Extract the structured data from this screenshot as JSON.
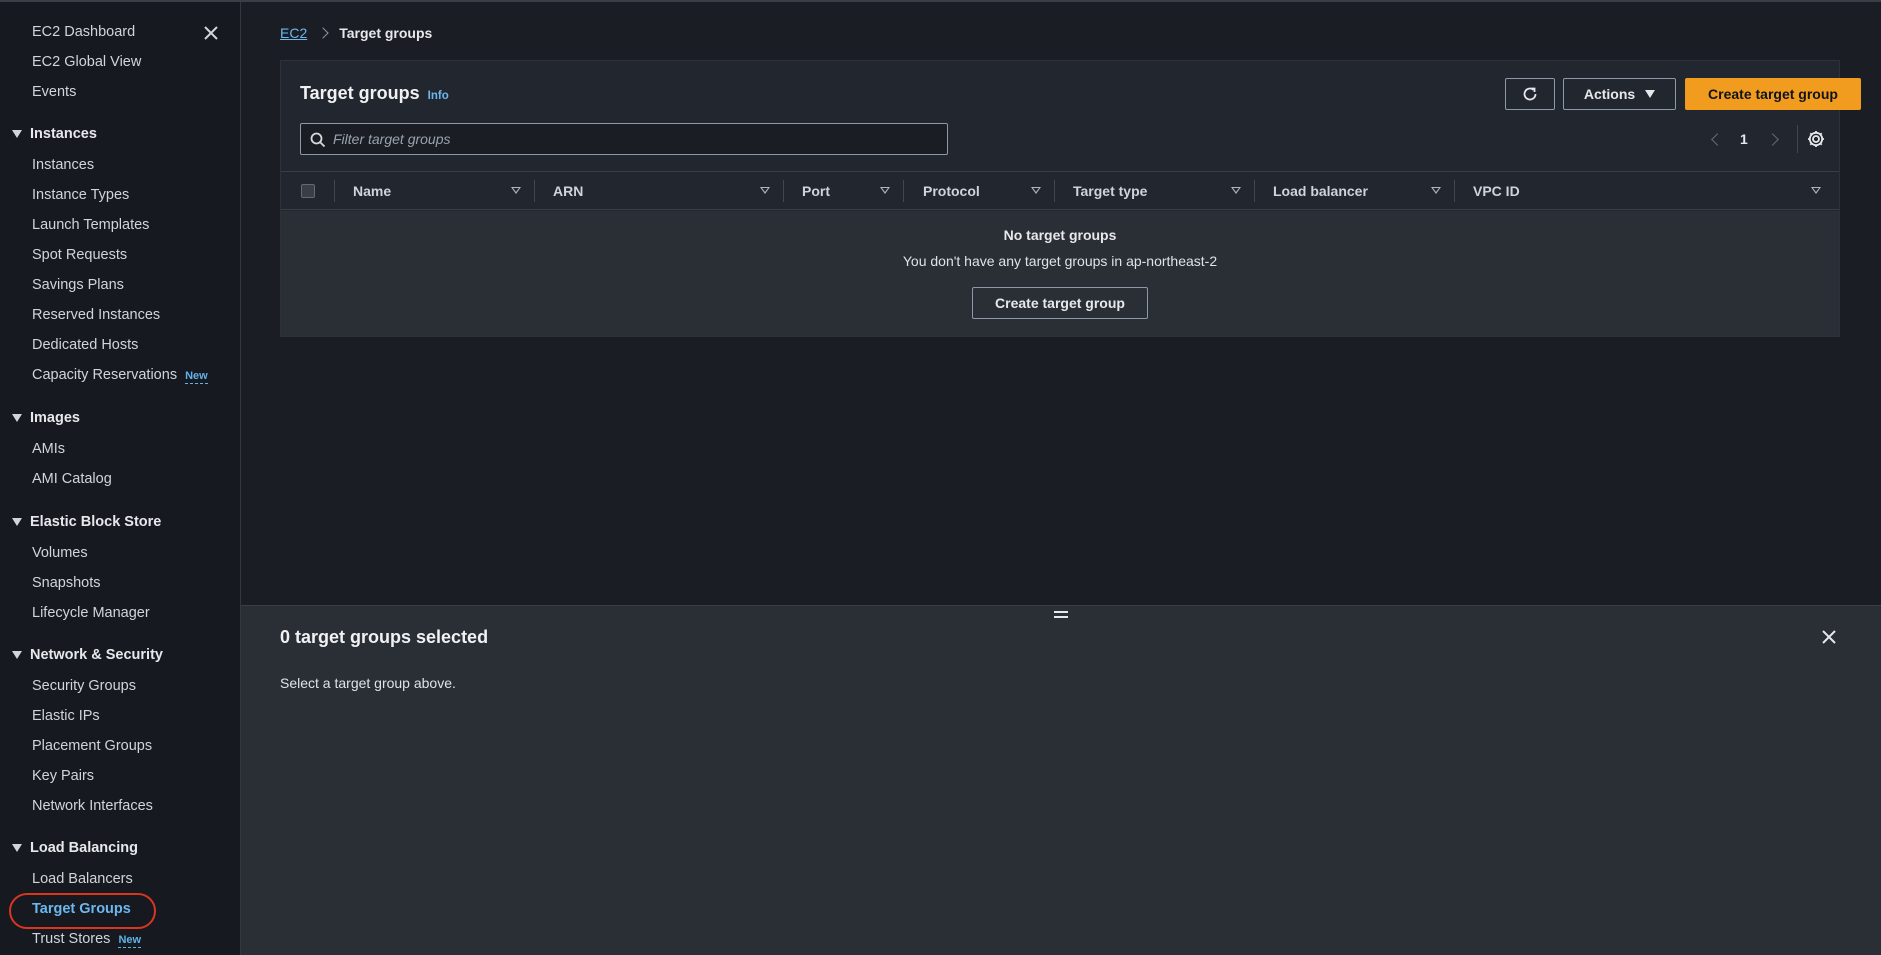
{
  "sidebar": {
    "top_items": [
      "EC2 Dashboard",
      "EC2 Global View",
      "Events"
    ],
    "sections": [
      {
        "title": "Instances",
        "items": [
          "Instances",
          "Instance Types",
          "Launch Templates",
          "Spot Requests",
          "Savings Plans",
          "Reserved Instances",
          "Dedicated Hosts",
          "Capacity Reservations"
        ]
      },
      {
        "title": "Images",
        "items": [
          "AMIs",
          "AMI Catalog"
        ]
      },
      {
        "title": "Elastic Block Store",
        "items": [
          "Volumes",
          "Snapshots",
          "Lifecycle Manager"
        ]
      },
      {
        "title": "Network & Security",
        "items": [
          "Security Groups",
          "Elastic IPs",
          "Placement Groups",
          "Key Pairs",
          "Network Interfaces"
        ]
      },
      {
        "title": "Load Balancing",
        "items": [
          "Load Balancers",
          "Target Groups",
          "Trust Stores"
        ]
      }
    ],
    "new_badge": "New",
    "active_item": "Target Groups"
  },
  "breadcrumb": {
    "root": "EC2",
    "current": "Target groups"
  },
  "panel": {
    "title": "Target groups",
    "info": "Info",
    "actions_label": "Actions",
    "create_label": "Create target group",
    "search_placeholder": "Filter target groups",
    "page": "1",
    "columns": [
      "Name",
      "ARN",
      "Port",
      "Protocol",
      "Target type",
      "Load balancer",
      "VPC ID"
    ],
    "empty_title": "No target groups",
    "empty_sub": "You don't have any target groups in ap-northeast-2",
    "empty_create_label": "Create target group"
  },
  "split": {
    "title": "0 target groups selected",
    "subtitle": "Select a target group above."
  },
  "colors": {
    "accent": "#f29c1f",
    "link": "#6cb8ee",
    "highlight_circle": "#d9361e"
  }
}
